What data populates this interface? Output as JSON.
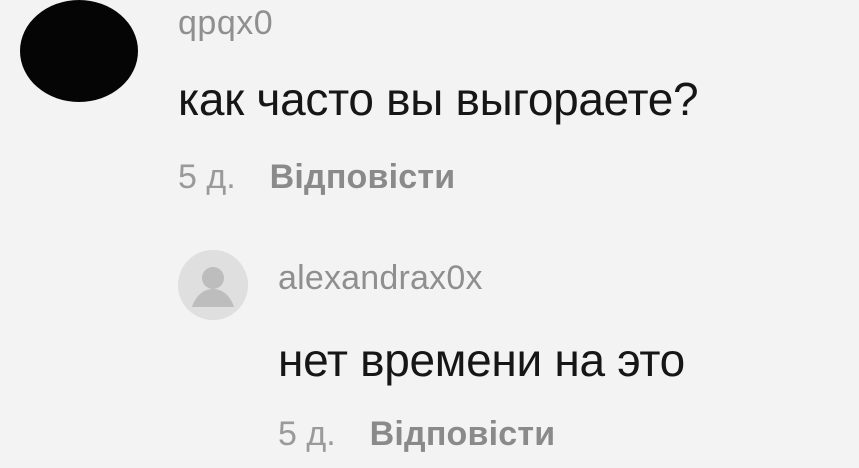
{
  "comment": {
    "username": "qpqx0",
    "text": "как часто вы выгораете?",
    "time": "5 д.",
    "reply_label": "Відповісти"
  },
  "reply": {
    "username": "alexandrax0x",
    "text": "нет времени на это",
    "time": "5 д.",
    "reply_label": "Відповісти"
  },
  "icons": {
    "main_avatar": "user-avatar-icon",
    "reply_avatar": "default-avatar-icon"
  }
}
